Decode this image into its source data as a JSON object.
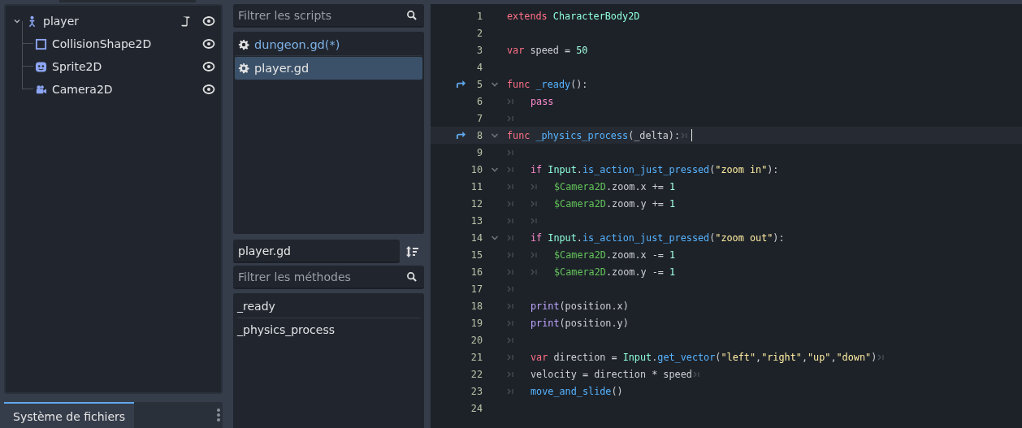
{
  "scene_tree": {
    "root": {
      "label": "player",
      "kind": "body",
      "has_script": true,
      "visible": true,
      "expanded": true,
      "children": [
        {
          "label": "CollisionShape2D",
          "kind": "shape",
          "visible": true
        },
        {
          "label": "Sprite2D",
          "kind": "sprite",
          "visible": true
        },
        {
          "label": "Camera2D",
          "kind": "camera",
          "visible": true
        }
      ]
    }
  },
  "bottom_dock": {
    "tabs": [
      {
        "label": "Système de fichiers",
        "selected": true
      }
    ]
  },
  "scripts": {
    "filter": {
      "placeholder": "Filtrer les scripts"
    },
    "items": [
      {
        "label": "dungeon.gd(*)",
        "selected": false,
        "color": "#7fb2e8"
      },
      {
        "label": "player.gd",
        "selected": true,
        "color": "#e6e6e6"
      }
    ]
  },
  "methods": {
    "current_script": "player.gd",
    "filter": {
      "placeholder": "Filtrer les méthodes"
    },
    "items": [
      {
        "label": "_ready"
      },
      {
        "label": "_physics_process"
      }
    ]
  },
  "editor": {
    "lines": [
      {
        "number": "1",
        "tokens": [
          {
            "kind": "kw",
            "t": "extends "
          },
          {
            "kind": "type",
            "t": "CharacterBody2D"
          }
        ]
      },
      {
        "number": "2"
      },
      {
        "number": "3",
        "tokens": [
          {
            "kind": "kw",
            "t": "var "
          },
          {
            "kind": "plain",
            "t": "speed = "
          },
          {
            "kind": "num",
            "t": "50"
          }
        ]
      },
      {
        "number": "4"
      },
      {
        "number": "5",
        "override": true,
        "fold": true,
        "tokens": [
          {
            "kind": "kw",
            "t": "func "
          },
          {
            "kind": "fn",
            "t": "_ready"
          },
          {
            "kind": "plain",
            "t": "():"
          }
        ]
      },
      {
        "number": "6",
        "tokens": [
          {
            "kind": "tab"
          },
          {
            "kind": "ctrl",
            "t": "pass"
          }
        ]
      },
      {
        "number": "7",
        "tokens": [
          {
            "kind": "tab"
          }
        ]
      },
      {
        "number": "8",
        "override": true,
        "fold": true,
        "current": true,
        "tokens": [
          {
            "kind": "kw",
            "t": "func "
          },
          {
            "kind": "fn",
            "t": "_physics_process"
          },
          {
            "kind": "plain",
            "t": "(_delta):"
          },
          {
            "kind": "tab"
          }
        ]
      },
      {
        "number": "9",
        "tokens": [
          {
            "kind": "tab"
          }
        ]
      },
      {
        "number": "10",
        "fold": true,
        "tokens": [
          {
            "kind": "tab"
          },
          {
            "kind": "ctrl",
            "t": "if "
          },
          {
            "kind": "type",
            "t": "Input"
          },
          {
            "kind": "plain",
            "t": "."
          },
          {
            "kind": "fn",
            "t": "is_action_just_pressed"
          },
          {
            "kind": "plain",
            "t": "("
          },
          {
            "kind": "str",
            "t": "\"zoom in\""
          },
          {
            "kind": "plain",
            "t": "):"
          }
        ]
      },
      {
        "number": "11",
        "tokens": [
          {
            "kind": "tab"
          },
          {
            "kind": "tab"
          },
          {
            "kind": "node",
            "t": "$Camera2D"
          },
          {
            "kind": "plain",
            "t": ".zoom.x += "
          },
          {
            "kind": "num",
            "t": "1"
          }
        ]
      },
      {
        "number": "12",
        "tokens": [
          {
            "kind": "tab"
          },
          {
            "kind": "tab"
          },
          {
            "kind": "node",
            "t": "$Camera2D"
          },
          {
            "kind": "plain",
            "t": ".zoom.y += "
          },
          {
            "kind": "num",
            "t": "1"
          }
        ]
      },
      {
        "number": "13",
        "tokens": [
          {
            "kind": "tab"
          },
          {
            "kind": "tab"
          }
        ]
      },
      {
        "number": "14",
        "fold": true,
        "tokens": [
          {
            "kind": "tab"
          },
          {
            "kind": "ctrl",
            "t": "if "
          },
          {
            "kind": "type",
            "t": "Input"
          },
          {
            "kind": "plain",
            "t": "."
          },
          {
            "kind": "fn",
            "t": "is_action_just_pressed"
          },
          {
            "kind": "plain",
            "t": "("
          },
          {
            "kind": "str",
            "t": "\"zoom out\""
          },
          {
            "kind": "plain",
            "t": "):"
          }
        ]
      },
      {
        "number": "15",
        "tokens": [
          {
            "kind": "tab"
          },
          {
            "kind": "tab"
          },
          {
            "kind": "node",
            "t": "$Camera2D"
          },
          {
            "kind": "plain",
            "t": ".zoom.x -= "
          },
          {
            "kind": "num",
            "t": "1"
          }
        ]
      },
      {
        "number": "16",
        "tokens": [
          {
            "kind": "tab"
          },
          {
            "kind": "tab"
          },
          {
            "kind": "node",
            "t": "$Camera2D"
          },
          {
            "kind": "plain",
            "t": ".zoom.y -= "
          },
          {
            "kind": "num",
            "t": "1"
          }
        ]
      },
      {
        "number": "17",
        "tokens": [
          {
            "kind": "tab"
          }
        ]
      },
      {
        "number": "18",
        "tokens": [
          {
            "kind": "tab"
          },
          {
            "kind": "builtin",
            "t": "print"
          },
          {
            "kind": "plain",
            "t": "(position.x)"
          }
        ]
      },
      {
        "number": "19",
        "tokens": [
          {
            "kind": "tab"
          },
          {
            "kind": "builtin",
            "t": "print"
          },
          {
            "kind": "plain",
            "t": "(position.y)"
          }
        ]
      },
      {
        "number": "20",
        "tokens": [
          {
            "kind": "tab"
          }
        ]
      },
      {
        "number": "21",
        "tokens": [
          {
            "kind": "tab"
          },
          {
            "kind": "kw",
            "t": "var "
          },
          {
            "kind": "plain",
            "t": "direction = "
          },
          {
            "kind": "type",
            "t": "Input"
          },
          {
            "kind": "plain",
            "t": "."
          },
          {
            "kind": "fn",
            "t": "get_vector"
          },
          {
            "kind": "plain",
            "t": "("
          },
          {
            "kind": "str",
            "t": "\"left\""
          },
          {
            "kind": "plain",
            "t": ","
          },
          {
            "kind": "str",
            "t": "\"right\""
          },
          {
            "kind": "plain",
            "t": ","
          },
          {
            "kind": "str",
            "t": "\"up\""
          },
          {
            "kind": "plain",
            "t": ","
          },
          {
            "kind": "str",
            "t": "\"down\""
          },
          {
            "kind": "plain",
            "t": ")"
          },
          {
            "kind": "tab"
          }
        ]
      },
      {
        "number": "22",
        "tokens": [
          {
            "kind": "tab"
          },
          {
            "kind": "plain",
            "t": "velocity = direction * speed"
          },
          {
            "kind": "tab"
          }
        ]
      },
      {
        "number": "23",
        "tokens": [
          {
            "kind": "tab"
          },
          {
            "kind": "fn",
            "t": "move_and_slide"
          },
          {
            "kind": "plain",
            "t": "()"
          }
        ]
      },
      {
        "number": "24"
      }
    ]
  }
}
